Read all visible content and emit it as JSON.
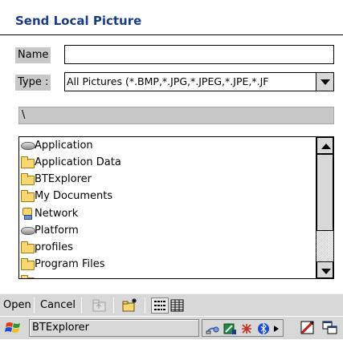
{
  "dialog": {
    "title": "Send Local Picture"
  },
  "form": {
    "name_label": "Name",
    "name_value": "",
    "type_label": "Type :",
    "type_value": "All Pictures (*.BMP,*.JPG,*.JPEG,*.JPE,*.JF"
  },
  "path": {
    "current": "\\"
  },
  "file_list": {
    "items": [
      {
        "label": "Application",
        "icon": "drive-icon"
      },
      {
        "label": "Application Data",
        "icon": "folder-icon"
      },
      {
        "label": "BTExplorer",
        "icon": "folder-icon"
      },
      {
        "label": "My Documents",
        "icon": "folder-icon"
      },
      {
        "label": "Network",
        "icon": "network-folder-icon"
      },
      {
        "label": "Platform",
        "icon": "drive-icon"
      },
      {
        "label": "profiles",
        "icon": "folder-icon"
      },
      {
        "label": "Program Files",
        "icon": "folder-icon"
      }
    ]
  },
  "toolbar": {
    "open_label": "Open",
    "cancel_label": "Cancel",
    "icons": [
      "up-folder-icon",
      "new-folder-icon",
      "list-view-icon",
      "details-view-icon"
    ]
  },
  "taskbar": {
    "start_icon": "windows-flag-icon",
    "task_label": "BTExplorer",
    "tray_icons": [
      "network-icon",
      "signal-icon",
      "bluetooth-icon",
      "arrow-right-icon"
    ],
    "right_icons": [
      "input-panel-icon",
      "desktop-switch-icon"
    ]
  },
  "colors": {
    "title": "#1a3c8c",
    "chrome": "#d8d8d8",
    "label_bg": "#c8c8c8"
  }
}
